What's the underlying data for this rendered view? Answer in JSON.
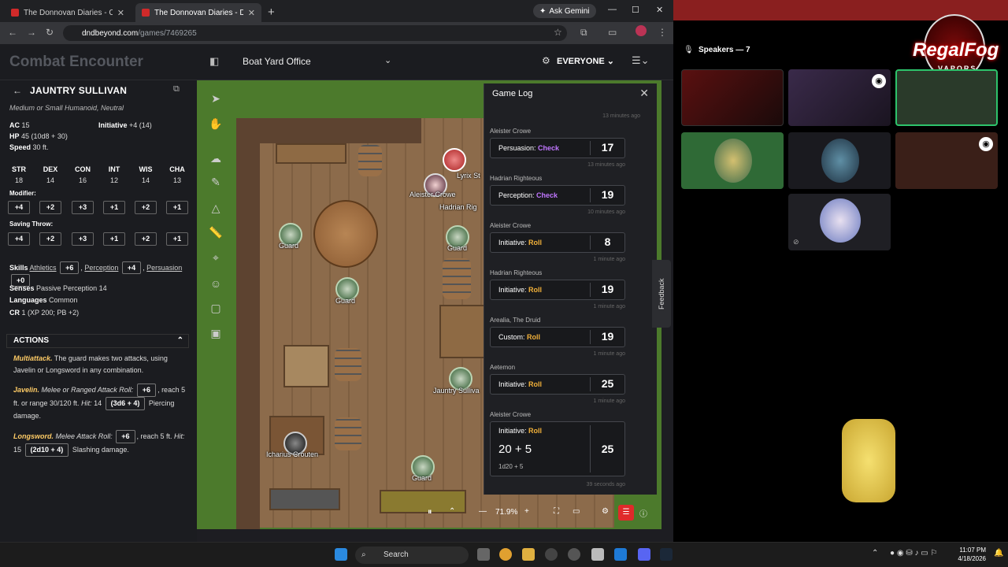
{
  "browser": {
    "tabs": [
      {
        "title": "The Donnovan Diaries - Campa"
      },
      {
        "title": "The Donnovan Diaries - D&D B"
      }
    ],
    "ask_gemini": "Ask Gemini",
    "url_host": "dndbeyond.com",
    "url_path": "/games/7469265"
  },
  "header": {
    "title": "Combat Encounter",
    "map_name": "Boat Yard Office",
    "visibility": "EVERYONE"
  },
  "monster": {
    "name": "JAUNTRY SULLIVAN",
    "type_line": "Medium or Small Humanoid, Neutral",
    "ac_label": "AC",
    "ac": "15",
    "hp_label": "HP",
    "hp": "45 (10d8 + 30)",
    "speed_label": "Speed",
    "speed": "30 ft.",
    "initiative_label": "Initiative",
    "initiative": "+4 (14)",
    "abilities": [
      "STR",
      "DEX",
      "CON",
      "INT",
      "WIS",
      "CHA"
    ],
    "scores": [
      "18",
      "14",
      "16",
      "12",
      "14",
      "13"
    ],
    "modifier_label": "Modifier:",
    "modifiers": [
      "+4",
      "+2",
      "+3",
      "+1",
      "+2",
      "+1"
    ],
    "saving_label": "Saving Throw:",
    "saves": [
      "+4",
      "+2",
      "+3",
      "+1",
      "+2",
      "+1"
    ],
    "skills_label": "Skills",
    "skill1": "Athletics",
    "skill1_val": "+6",
    "skill2": "Perception",
    "skill2_val": "+4",
    "skill3": "Persuasion",
    "skill3_val": "+0",
    "senses_label": "Senses",
    "senses": "Passive Perception 14",
    "languages_label": "Languages",
    "languages": "Common",
    "cr_label": "CR",
    "cr": "1 (XP 200; PB +2)",
    "actions_header": "ACTIONS",
    "multiattack_name": "Multiattack.",
    "multiattack_text": "The guard makes two attacks, using Javelin or Longsword in any combination.",
    "javelin_name": "Javelin.",
    "javelin_type": "Melee or Ranged Attack Roll:",
    "javelin_bonus": "+6",
    "javelin_range": ", reach 5 ft. or range 30/120 ft.",
    "javelin_hit_label": "Hit:",
    "javelin_hit": "14",
    "javelin_dice": "(3d6 + 4)",
    "javelin_damage": "Piercing damage.",
    "longsword_name": "Longsword.",
    "longsword_type": "Melee Attack Roll:",
    "longsword_bonus": "+6",
    "longsword_reach": ", reach 5 ft.",
    "longsword_hit_label": "Hit:",
    "longsword_hit": "15",
    "longsword_dice": "(2d10 + 4)",
    "longsword_damage": "Slashing damage."
  },
  "map": {
    "tokens": [
      {
        "label": "Guard"
      },
      {
        "label": "Guard"
      },
      {
        "label": "Guard"
      },
      {
        "label": "Guard"
      },
      {
        "label": "Aleister Crowe"
      },
      {
        "label": "Hadrian Rig"
      },
      {
        "label": "Lyrix St"
      },
      {
        "label": "Jauntry Sulliva"
      },
      {
        "label": "Icharius Crouten"
      }
    ],
    "zoom": "71.9%"
  },
  "game_log": {
    "title": "Game Log",
    "top_time": "13 minutes ago",
    "entries": [
      {
        "name": "Aleister Crowe",
        "type": "Persuasion:",
        "kind": "Check",
        "result": "17",
        "time": "13 minutes ago"
      },
      {
        "name": "Hadrian Righteous",
        "type": "Perception:",
        "kind": "Check",
        "result": "19",
        "time": "10 minutes ago"
      },
      {
        "name": "Aleister Crowe",
        "type": "Initiative:",
        "kind": "Roll",
        "result": "8",
        "time": "1 minute ago"
      },
      {
        "name": "Hadrian Righteous",
        "type": "Initiative:",
        "kind": "Roll",
        "result": "19",
        "time": "1 minute ago"
      },
      {
        "name": "Arealia, The Druid",
        "type": "Custom:",
        "kind": "Roll",
        "result": "19",
        "time": "1 minute ago"
      },
      {
        "name": "Aetemon",
        "type": "Initiative:",
        "kind": "Roll",
        "result": "25",
        "time": "1 minute ago"
      }
    ],
    "last": {
      "name": "Aleister Crowe",
      "type": "Initiative:",
      "kind": "Roll",
      "expr": "20 + 5",
      "dice": "1d20 + 5",
      "result": "25",
      "time": "39 seconds ago"
    }
  },
  "feedback": "Feedback",
  "discord": {
    "speakers": "Speakers — 7",
    "logo_text": "RegalFog",
    "logo_sub": "VAPORS"
  },
  "taskbar": {
    "search": "Search",
    "time": "11:07 PM",
    "date": "4/18/2026"
  },
  "colors": {
    "check": "#c177ff",
    "roll": "#f2b13a",
    "grass": "#4c7a2c"
  }
}
